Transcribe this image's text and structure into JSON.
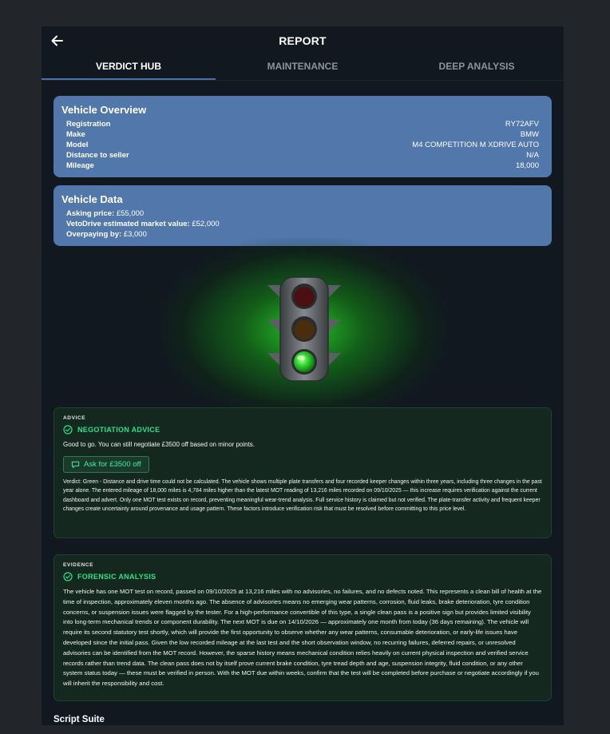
{
  "header": {
    "title": "REPORT",
    "back_icon": "arrow-left-icon"
  },
  "tabs": [
    {
      "label": "VERDICT HUB",
      "active": true
    },
    {
      "label": "MAINTENANCE",
      "active": false
    },
    {
      "label": "DEEP ANALYSIS",
      "active": false
    }
  ],
  "overview": {
    "title": "Vehicle Overview",
    "rows": [
      {
        "label": "Registration",
        "value": "RY72AFV"
      },
      {
        "label": "Make",
        "value": "BMW"
      },
      {
        "label": "Model",
        "value": "M4 COMPETITION M XDRIVE AUTO"
      },
      {
        "label": "Distance to seller",
        "value": "N/A"
      },
      {
        "label": "Mileage",
        "value": "18,000"
      }
    ]
  },
  "vehicle_data": {
    "title": "Vehicle Data",
    "rows": [
      {
        "label": "Asking price:",
        "value": "£55,000"
      },
      {
        "label": "VetoDrive estimated market value:",
        "value": "£52,000"
      },
      {
        "label": "Overpaying by:",
        "value": "£3,000"
      }
    ]
  },
  "traffic_light": {
    "state": "green",
    "color": "#2ecc40"
  },
  "advice": {
    "eyebrow": "ADVICE",
    "title": "NEGOTIATION ADVICE",
    "summary": "Good to go. You can still negotiate £3500 off based on minor points.",
    "button": "Ask for £3500 off",
    "verdict": "Verdict: Green - Distance and drive time could not be calculated. The vehicle shows multiple plate transfers and four recorded keeper changes within three years, including three changes in the past year alone. The entered mileage of 18,000 miles is 4,784 miles higher than the latest MOT reading of 13,216 miles recorded on 09/10/2025 — this increase requires verification against the current dashboard and advert. Only one MOT test exists on record, preventing meaningful wear-trend analysis. Full service history is claimed but not verified. The plate-transfer activity and frequent keeper changes create uncertainty around provenance and usage pattern. These factors introduce verification risk that must be resolved before committing to this price level."
  },
  "evidence": {
    "eyebrow": "EVIDENCE",
    "title": "FORENSIC ANALYSIS",
    "body": "The vehicle has one MOT test on record, passed on 09/10/2025 at 13,216 miles with no advisories, no failures, and no defects noted. This represents a clean bill of health at the time of inspection, approximately eleven months ago. The absence of advisories means no emerging wear patterns, corrosion, fluid leaks, brake deterioration, tyre condition concerns, or suspension issues were flagged by the tester. For a high-performance convertible of this type, a single clean pass is a positive sign but provides limited visibility into long-term mechanical trends or component durability. The next MOT is due on 14/10/2026 — approximately one month from today (36 days remaining). The vehicle will require its second statutory test shortly, which will provide the first opportunity to observe whether any wear patterns, consumable deterioration, or early-life issues have developed since the initial pass. Given the low recorded mileage at the last test and the short observation window, no recurring failures, deferred repairs, or unresolved advisories can be identified from the MOT record. However, the sparse history means mechanical condition relies heavily on current physical inspection and verified service records rather than trend data. The clean pass does not by itself prove current brake condition, tyre tread depth and age, suspension integrity, fluid condition, or any other system status today — these must be verified in person. With the MOT due within weeks, confirm that the test will be completed before purchase or negotiate accordingly if you will inherit the responsibility and cost."
  },
  "script_suite": {
    "title": "Script Suite"
  }
}
